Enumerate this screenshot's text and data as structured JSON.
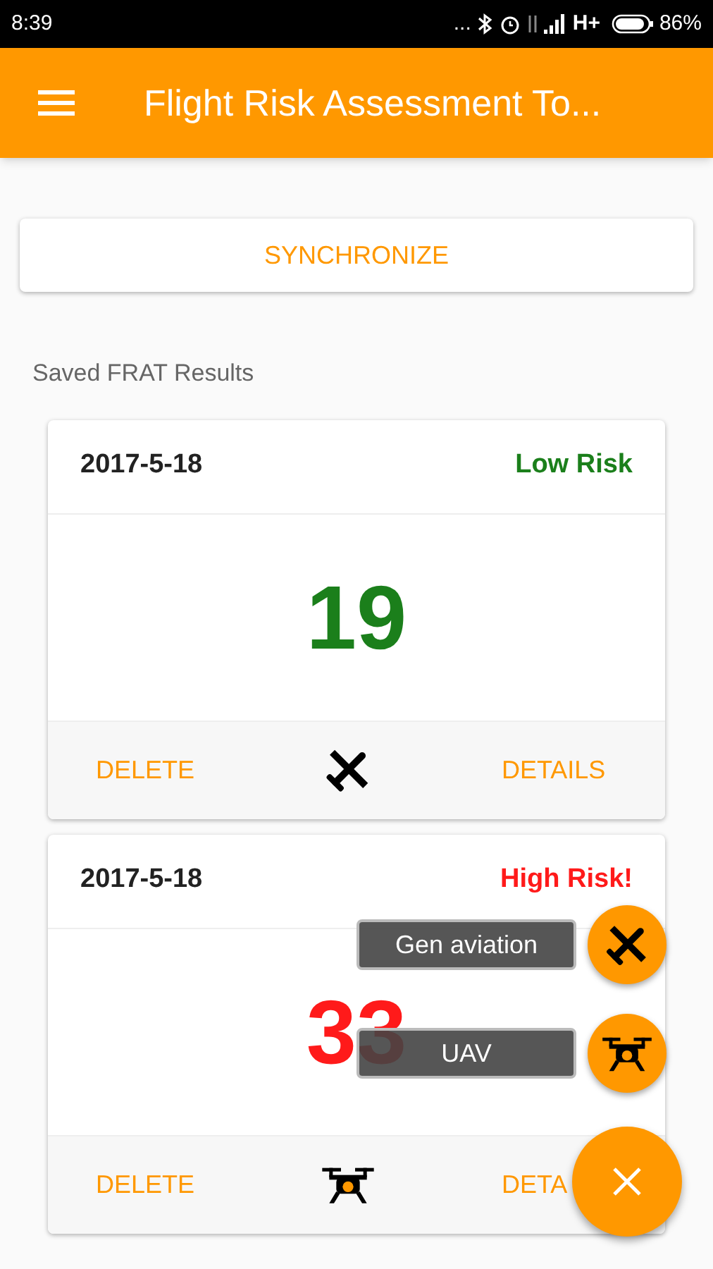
{
  "status_bar": {
    "time": "8:39",
    "more": "...",
    "network": "H+",
    "battery": "86%"
  },
  "app_bar": {
    "title": "Flight Risk Assessment To..."
  },
  "sync_button": "SYNCHRONIZE",
  "section_title": "Saved FRAT Results",
  "cards": [
    {
      "date": "2017-5-18",
      "risk_label": "Low Risk",
      "color": "#1b7f1b",
      "score": "19",
      "delete": "DELETE",
      "kind": "airplane",
      "details": "DETAILS"
    },
    {
      "date": "2017-5-18",
      "risk_label": "High Risk!",
      "color": "#ff1a1a",
      "score": "33",
      "delete": "DELETE",
      "kind": "drone",
      "details": "DETA"
    }
  ],
  "fab_menu": {
    "expanded": true,
    "items": [
      {
        "label": "Gen aviation",
        "kind": "airplane"
      },
      {
        "label": "UAV",
        "kind": "drone"
      }
    ]
  }
}
